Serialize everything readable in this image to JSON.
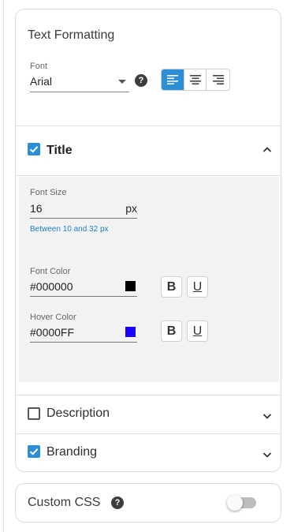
{
  "text_formatting": {
    "title": "Text Formatting",
    "font_label": "Font",
    "font_value": "Arial",
    "help_icon": "help-icon",
    "alignment": {
      "options": [
        "align-left-icon",
        "align-center-icon",
        "align-right-icon"
      ],
      "selected": "left"
    }
  },
  "sections": {
    "title": {
      "label": "Title",
      "checked": true,
      "expanded": true,
      "font_size_label": "Font Size",
      "font_size_value": "16",
      "font_size_unit": "px",
      "font_size_hint": "Between 10 and 32 px",
      "font_color_label": "Font Color",
      "font_color_value": "#000000",
      "hover_color_label": "Hover Color",
      "hover_color_value": "#0000FF",
      "bold_label": "B",
      "underline_label": "U"
    },
    "description": {
      "label": "Description",
      "checked": false,
      "expanded": false
    },
    "branding": {
      "label": "Branding",
      "checked": true,
      "expanded": false
    }
  },
  "custom_css": {
    "label": "Custom CSS",
    "enabled": false
  },
  "colors": {
    "accent": "#2b8fd6",
    "hint": "#1a7fc8",
    "font_color_swatch": "#000000",
    "hover_color_swatch": "#1a00ff"
  }
}
